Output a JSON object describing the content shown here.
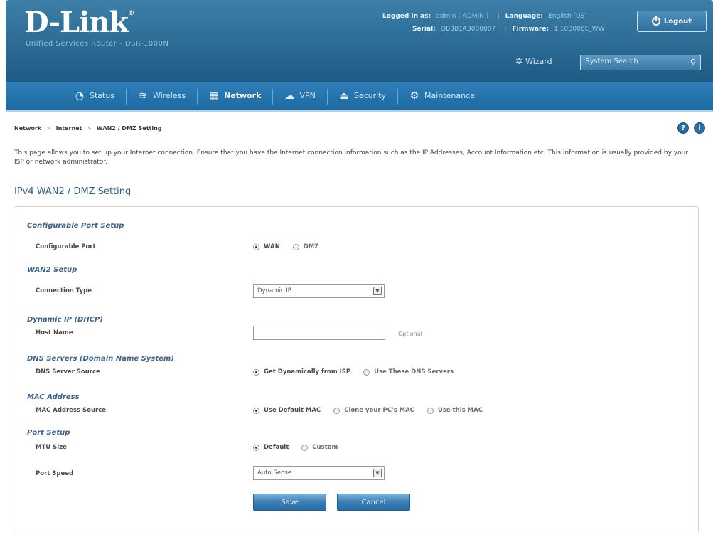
{
  "header": {
    "brand": "D-Link",
    "brand_mark": "®",
    "brand_sub": "Unified Services Router - DSR-1000N",
    "logged_in_label": "Logged in as:",
    "logged_in_value": "admin ( ADMIN )",
    "language_label": "Language:",
    "language_value": "English [US]",
    "serial_label": "Serial:",
    "serial_value": "QB3B1A3000007",
    "firmware_label": "Firmware:",
    "firmware_value": "1.10B006E_WW",
    "logout_label": "Logout",
    "wizard_label": "Wizard",
    "search_placeholder": "System Search"
  },
  "nav": {
    "items": [
      {
        "label": "Status",
        "icon": "gauge-icon"
      },
      {
        "label": "Wireless",
        "icon": "wifi-icon"
      },
      {
        "label": "Network",
        "icon": "network-icon"
      },
      {
        "label": "VPN",
        "icon": "vpn-icon"
      },
      {
        "label": "Security",
        "icon": "lock-icon"
      },
      {
        "label": "Maintenance",
        "icon": "gears-icon"
      }
    ],
    "active": "Network"
  },
  "breadcrumb": [
    "Network",
    "Internet",
    "WAN2 / DMZ Setting"
  ],
  "breadcrumb_sep": "»",
  "intro": "This page allows you to set up your Internet connection. Ensure that you have the Internet connection information such as the IP Addresses, Account Information etc. This information is usually provided by your ISP or network administrator.",
  "page_title": "IPv4 WAN2 / DMZ Setting",
  "form": {
    "sec_port_setup": "Configurable Port Setup",
    "configurable_port_label": "Configurable Port",
    "port_options": [
      "WAN",
      "DMZ"
    ],
    "sec_wan2": "WAN2 Setup",
    "connection_type_label": "Connection Type",
    "connection_type_value": "Dynamic IP",
    "sec_dhcp": "Dynamic IP (DHCP)",
    "host_name_label": "Host Name",
    "host_name_value": "",
    "optional_hint": "Optional",
    "sec_dns": "DNS Servers (Domain Name System)",
    "dns_source_label": "DNS Server Source",
    "dns_options": [
      "Get Dynamically from ISP",
      "Use These DNS Servers"
    ],
    "sec_mac": "MAC Address",
    "mac_source_label": "MAC Address Source",
    "mac_options": [
      "Use Default MAC",
      "Clone your PC's MAC",
      "Use this MAC"
    ],
    "sec_port": "Port Setup",
    "mtu_label": "MTU Size",
    "mtu_options": [
      "Default",
      "Custom"
    ],
    "port_speed_label": "Port Speed",
    "port_speed_value": "Auto Sense",
    "save_label": "Save",
    "cancel_label": "Cancel"
  }
}
